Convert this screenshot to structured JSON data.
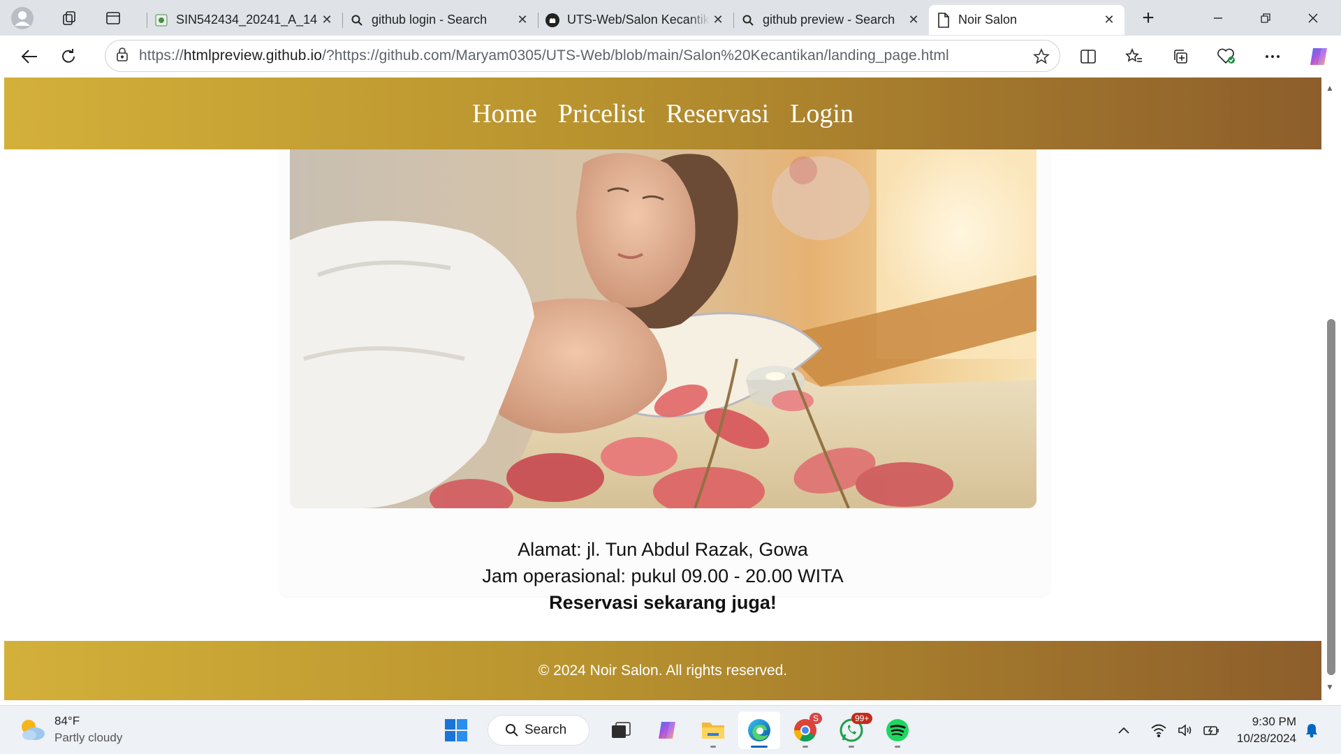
{
  "browser": {
    "tabs": [
      {
        "title": "SIN542434_20241_A_14",
        "icon": "site-logo-icon",
        "active": false
      },
      {
        "title": "github login - Search",
        "icon": "search-icon",
        "active": false
      },
      {
        "title": "UTS-Web/Salon Kecantikan",
        "icon": "github-icon",
        "active": false
      },
      {
        "title": "github preview - Search",
        "icon": "search-icon",
        "active": false
      },
      {
        "title": "Noir Salon",
        "icon": "page-icon",
        "active": true
      }
    ],
    "tab_close_glyph": "✕",
    "new_tab_glyph": "+",
    "url_prefix": "https://",
    "url_host": "htmlpreview.github.io",
    "url_rest": "/?https://github.com/Maryam0305/UTS-Web/blob/main/Salon%20Kecantikan/landing_page.html"
  },
  "site": {
    "nav": [
      "Home",
      "Pricelist",
      "Reservasi",
      "Login"
    ],
    "address": "Alamat: jl. Tun Abdul Razak, Gowa",
    "hours": "Jam operasional: pukul 09.00 - 20.00 WITA",
    "cta": "Reservasi sekarang juga!",
    "footer": "© 2024 Noir Salon. All rights reserved.",
    "colors": {
      "gold_light": "#d3b03a",
      "gold_dark": "#8d5e2b"
    }
  },
  "taskbar": {
    "weather_temp": "84°F",
    "weather_condition": "Partly cloudy",
    "search_label": "Search",
    "chrome_badge": "S",
    "whatsapp_badge": "99+",
    "time": "9:30 PM",
    "date": "10/28/2024"
  }
}
